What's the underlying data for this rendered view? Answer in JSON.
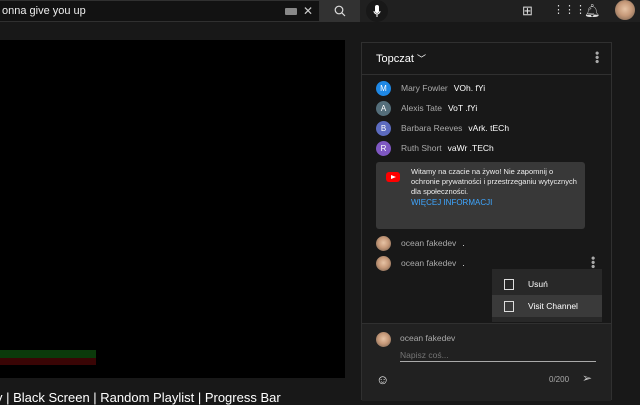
{
  "header": {
    "search_value": "onna give you up"
  },
  "video": {
    "title": "y | Black Screen | Random Playlist | Progress Bar"
  },
  "chat": {
    "mode_label": "Topczat",
    "messages": [
      {
        "initial": "M",
        "author": "Mary Fowler",
        "text": "VOh. fYi",
        "color": "#1e88e5"
      },
      {
        "initial": "A",
        "author": "Alexis Tate",
        "text": "VoT .fYi",
        "color": "#546e7a"
      },
      {
        "initial": "B",
        "author": "Barbara Reeves",
        "text": "vArk. tECh",
        "color": "#5c6bc0"
      },
      {
        "initial": "R",
        "author": "Ruth Short",
        "text": "vaWr .TECh",
        "color": "#7e57c2"
      }
    ],
    "notice": {
      "text": "Witamy na czacie na żywo! Nie zapomnij o ochronie prywatności i przestrzeganiu wytycznych dla społeczności.",
      "link": "WIĘCEJ INFORMACJI"
    },
    "own_messages": [
      {
        "author": "ocean fakedev",
        "text": "."
      },
      {
        "author": "ocean fakedev",
        "text": "."
      }
    ],
    "menu": {
      "delete": "Usuń",
      "visit": "Visit Channel"
    },
    "input": {
      "author": "ocean fakedev",
      "placeholder": "Napisz coś...",
      "count": "0/200"
    }
  }
}
